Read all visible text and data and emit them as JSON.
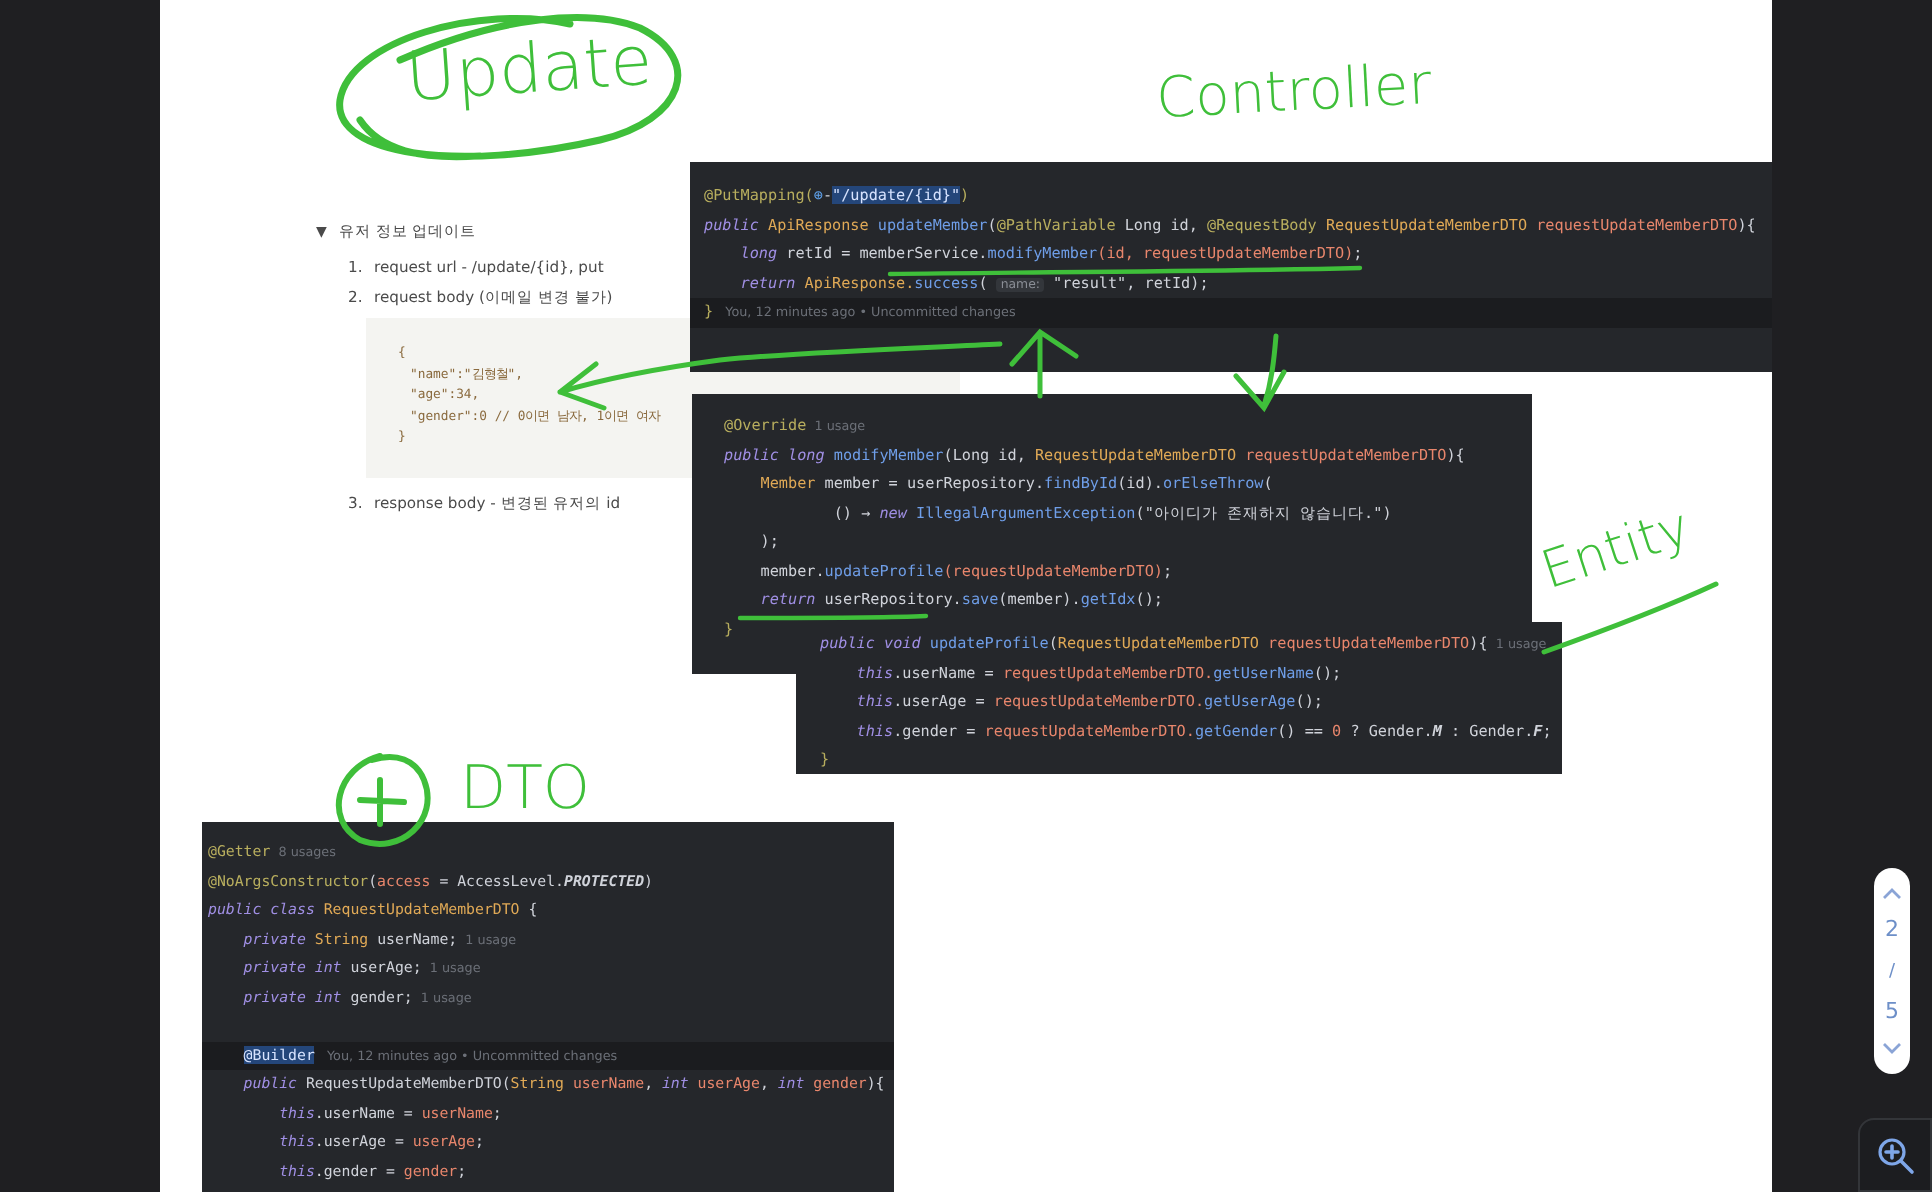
{
  "notes": {
    "toggle": {
      "icon": "▼",
      "title": "유저 정보 업데이트"
    },
    "items": [
      {
        "number": "1.",
        "text": "request url - /update/{id}, put"
      },
      {
        "number": "2.",
        "text": "request body (이메일 변경 불가)"
      }
    ],
    "code_sample": [
      "{",
      "\"name\":\"김형철\",",
      "\"age\":34,",
      "\"gender\":0 // 0이면 남자, 1이면 여자",
      "}"
    ],
    "items_after": [
      {
        "number": "3.",
        "text": "response body - 변경된 유저의 id"
      }
    ]
  },
  "code_snippets": [
    {
      "kind": "controller",
      "lines": [
        {
          "highlighted": false,
          "tokens": [
            {
              "kind": "an",
              "text": "@PutMapping("
            },
            {
              "kind": "icon",
              "text": "⊕"
            },
            {
              "kind": "plain",
              "text": "-"
            },
            {
              "kind": "sel",
              "text": "\"/update/{id}\""
            },
            {
              "kind": "an",
              "text": ")"
            }
          ]
        },
        {
          "highlighted": false,
          "tokens": [
            {
              "kind": "kw",
              "text": "public "
            },
            {
              "kind": "type",
              "text": "ApiResponse "
            },
            {
              "kind": "fn",
              "text": "updateMember"
            },
            {
              "kind": "plain",
              "text": "("
            },
            {
              "kind": "an",
              "text": "@PathVariable "
            },
            {
              "kind": "plain",
              "text": "Long id, "
            },
            {
              "kind": "an",
              "text": "@RequestBody "
            },
            {
              "kind": "type",
              "text": "RequestUpdateMemberDTO "
            },
            {
              "kind": "param",
              "text": "requestUpdateMemberDTO"
            },
            {
              "kind": "plain",
              "text": "){"
            }
          ]
        },
        {
          "highlighted": false,
          "tokens": [
            {
              "kind": "kw",
              "text": "    long "
            },
            {
              "kind": "plain",
              "text": "retId = memberService."
            },
            {
              "kind": "fn",
              "text": "modifyMember"
            },
            {
              "kind": "param",
              "text": "(id, requestUpdateMemberDTO)"
            },
            {
              "kind": "plain",
              "text": ";"
            }
          ]
        },
        {
          "highlighted": false,
          "tokens": [
            {
              "kind": "kw",
              "text": "    return "
            },
            {
              "kind": "type",
              "text": "ApiResponse."
            },
            {
              "kind": "fn",
              "text": "success"
            },
            {
              "kind": "plain",
              "text": "( "
            },
            {
              "kind": "inlay",
              "text": "name:"
            },
            {
              "kind": "plain",
              "text": " \"result\", retId);"
            }
          ]
        },
        {
          "highlighted": true,
          "tokens": [
            {
              "kind": "an",
              "text": "}"
            },
            {
              "kind": "hint",
              "text": "   You, 12 minutes ago • Uncommitted changes"
            }
          ]
        }
      ]
    },
    {
      "kind": "service",
      "lines": [
        {
          "highlighted": false,
          "tokens": [
            {
              "kind": "an",
              "text": "@Override"
            },
            {
              "kind": "hint",
              "text": "  1 usage"
            }
          ]
        },
        {
          "highlighted": false,
          "tokens": [
            {
              "kind": "kw",
              "text": "public long "
            },
            {
              "kind": "fn",
              "text": "modifyMember"
            },
            {
              "kind": "plain",
              "text": "(Long id, "
            },
            {
              "kind": "type",
              "text": "RequestUpdateMemberDTO "
            },
            {
              "kind": "param",
              "text": "requestUpdateMemberDTO"
            },
            {
              "kind": "plain",
              "text": "){"
            }
          ]
        },
        {
          "highlighted": false,
          "tokens": [
            {
              "kind": "type",
              "text": "    Member "
            },
            {
              "kind": "plain",
              "text": "member = userRepository."
            },
            {
              "kind": "fn",
              "text": "findById"
            },
            {
              "kind": "plain",
              "text": "(id)."
            },
            {
              "kind": "fn",
              "text": "orElseThrow"
            },
            {
              "kind": "plain",
              "text": "("
            }
          ]
        },
        {
          "highlighted": false,
          "tokens": [
            {
              "kind": "plain",
              "text": "            () → "
            },
            {
              "kind": "kw",
              "text": "new "
            },
            {
              "kind": "fn",
              "text": "IllegalArgumentException"
            },
            {
              "kind": "plain",
              "text": "(\"아이디가 존재하지 않습니다.\")"
            }
          ]
        },
        {
          "highlighted": false,
          "tokens": [
            {
              "kind": "plain",
              "text": "    );"
            }
          ]
        },
        {
          "highlighted": false,
          "tokens": [
            {
              "kind": "plain",
              "text": "    member."
            },
            {
              "kind": "fn",
              "text": "updateProfile"
            },
            {
              "kind": "param",
              "text": "(requestUpdateMemberDTO)"
            },
            {
              "kind": "plain",
              "text": ";"
            }
          ]
        },
        {
          "highlighted": false,
          "tokens": [
            {
              "kind": "kw",
              "text": "    return "
            },
            {
              "kind": "plain",
              "text": "userRepository."
            },
            {
              "kind": "fn",
              "text": "save"
            },
            {
              "kind": "plain",
              "text": "(member)."
            },
            {
              "kind": "fn",
              "text": "getIdx"
            },
            {
              "kind": "plain",
              "text": "();"
            }
          ]
        },
        {
          "highlighted": false,
          "tokens": [
            {
              "kind": "an",
              "text": "}"
            }
          ]
        }
      ]
    },
    {
      "kind": "entity",
      "lines": [
        {
          "highlighted": false,
          "tokens": [
            {
              "kind": "kw",
              "text": "public void "
            },
            {
              "kind": "fn",
              "text": "updateProfile"
            },
            {
              "kind": "plain",
              "text": "("
            },
            {
              "kind": "type",
              "text": "RequestUpdateMemberDTO "
            },
            {
              "kind": "param",
              "text": "requestUpdateMemberDTO"
            },
            {
              "kind": "plain",
              "text": "){"
            },
            {
              "kind": "hint",
              "text": "  1 usage"
            }
          ]
        },
        {
          "highlighted": false,
          "tokens": [
            {
              "kind": "kw",
              "text": "    this"
            },
            {
              "kind": "plain",
              "text": ".userName = "
            },
            {
              "kind": "param",
              "text": "requestUpdateMemberDTO."
            },
            {
              "kind": "fn",
              "text": "getUserName"
            },
            {
              "kind": "plain",
              "text": "();"
            }
          ]
        },
        {
          "highlighted": false,
          "tokens": [
            {
              "kind": "kw",
              "text": "    this"
            },
            {
              "kind": "plain",
              "text": ".userAge = "
            },
            {
              "kind": "param",
              "text": "requestUpdateMemberDTO."
            },
            {
              "kind": "fn",
              "text": "getUserAge"
            },
            {
              "kind": "plain",
              "text": "();"
            }
          ]
        },
        {
          "highlighted": false,
          "tokens": [
            {
              "kind": "kw",
              "text": "    this"
            },
            {
              "kind": "plain",
              "text": ".gender = "
            },
            {
              "kind": "param",
              "text": "requestUpdateMemberDTO."
            },
            {
              "kind": "fn",
              "text": "getGender"
            },
            {
              "kind": "plain",
              "text": "() == "
            },
            {
              "kind": "param",
              "text": "0"
            },
            {
              "kind": "plain",
              "text": " ? Gender."
            },
            {
              "kind": "const",
              "text": "M"
            },
            {
              "kind": "plain",
              "text": " : Gender."
            },
            {
              "kind": "const",
              "text": "F"
            },
            {
              "kind": "plain",
              "text": ";"
            }
          ]
        },
        {
          "highlighted": false,
          "tokens": [
            {
              "kind": "an",
              "text": "}"
            }
          ]
        }
      ]
    },
    {
      "kind": "dto",
      "lines": [
        {
          "highlighted": false,
          "tokens": [
            {
              "kind": "an",
              "text": "@Getter"
            },
            {
              "kind": "hint",
              "text": "  8 usages"
            }
          ]
        },
        {
          "highlighted": false,
          "tokens": [
            {
              "kind": "an",
              "text": "@NoArgsConstructor"
            },
            {
              "kind": "plain",
              "text": "("
            },
            {
              "kind": "param",
              "text": "access"
            },
            {
              "kind": "plain",
              "text": " = AccessLevel."
            },
            {
              "kind": "const",
              "text": "PROTECTED"
            },
            {
              "kind": "plain",
              "text": ")"
            }
          ]
        },
        {
          "highlighted": false,
          "tokens": [
            {
              "kind": "kw",
              "text": "public class "
            },
            {
              "kind": "type",
              "text": "RequestUpdateMemberDTO "
            },
            {
              "kind": "plain",
              "text": "{"
            }
          ]
        },
        {
          "highlighted": false,
          "tokens": [
            {
              "kind": "kw",
              "text": "    private "
            },
            {
              "kind": "type",
              "text": "String "
            },
            {
              "kind": "plain",
              "text": "userName;"
            },
            {
              "kind": "hint",
              "text": "  1 usage"
            }
          ]
        },
        {
          "highlighted": false,
          "tokens": [
            {
              "kind": "kw",
              "text": "    private int "
            },
            {
              "kind": "plain",
              "text": "userAge;"
            },
            {
              "kind": "hint",
              "text": "  1 usage"
            }
          ]
        },
        {
          "highlighted": false,
          "tokens": [
            {
              "kind": "kw",
              "text": "    private int "
            },
            {
              "kind": "plain",
              "text": "gender;"
            },
            {
              "kind": "hint",
              "text": "  1 usage"
            }
          ]
        },
        {
          "highlighted": false
        },
        {
          "highlighted": true,
          "tokens": [
            {
              "kind": "sel",
              "text": "@Builder"
            },
            {
              "kind": "hint",
              "text": "   You, 12 minutes ago • Uncommitted changes"
            }
          ]
        },
        {
          "highlighted": false,
          "tokens": [
            {
              "kind": "kw",
              "text": "    public "
            },
            {
              "kind": "plain",
              "text": "RequestUpdateMemberDTO("
            },
            {
              "kind": "type",
              "text": "String "
            },
            {
              "kind": "param",
              "text": "userName"
            },
            {
              "kind": "plain",
              "text": ", "
            },
            {
              "kind": "kw",
              "text": "int "
            },
            {
              "kind": "param",
              "text": "userAge"
            },
            {
              "kind": "plain",
              "text": ", "
            },
            {
              "kind": "kw",
              "text": "int "
            },
            {
              "kind": "param",
              "text": "gender"
            },
            {
              "kind": "plain",
              "text": "){"
            }
          ]
        },
        {
          "highlighted": false,
          "tokens": [
            {
              "kind": "kw",
              "text": "        this"
            },
            {
              "kind": "plain",
              "text": ".userName = "
            },
            {
              "kind": "param",
              "text": "userName"
            },
            {
              "kind": "plain",
              "text": ";"
            }
          ]
        },
        {
          "highlighted": false,
          "tokens": [
            {
              "kind": "kw",
              "text": "        this"
            },
            {
              "kind": "plain",
              "text": ".userAge = "
            },
            {
              "kind": "param",
              "text": "userAge"
            },
            {
              "kind": "plain",
              "text": ";"
            }
          ]
        },
        {
          "highlighted": false,
          "tokens": [
            {
              "kind": "kw",
              "text": "        this"
            },
            {
              "kind": "plain",
              "text": ".gender = "
            },
            {
              "kind": "param",
              "text": "gender"
            },
            {
              "kind": "plain",
              "text": ";"
            }
          ]
        }
      ]
    }
  ],
  "annotations": [
    {
      "kind": "update",
      "text": "Update"
    },
    {
      "kind": "controller",
      "text": "Controller"
    },
    {
      "kind": "entity",
      "text": "Entity"
    },
    {
      "kind": "dto",
      "text": "DTO"
    }
  ],
  "pager": {
    "current": "2",
    "separator": "/",
    "total": "5"
  }
}
